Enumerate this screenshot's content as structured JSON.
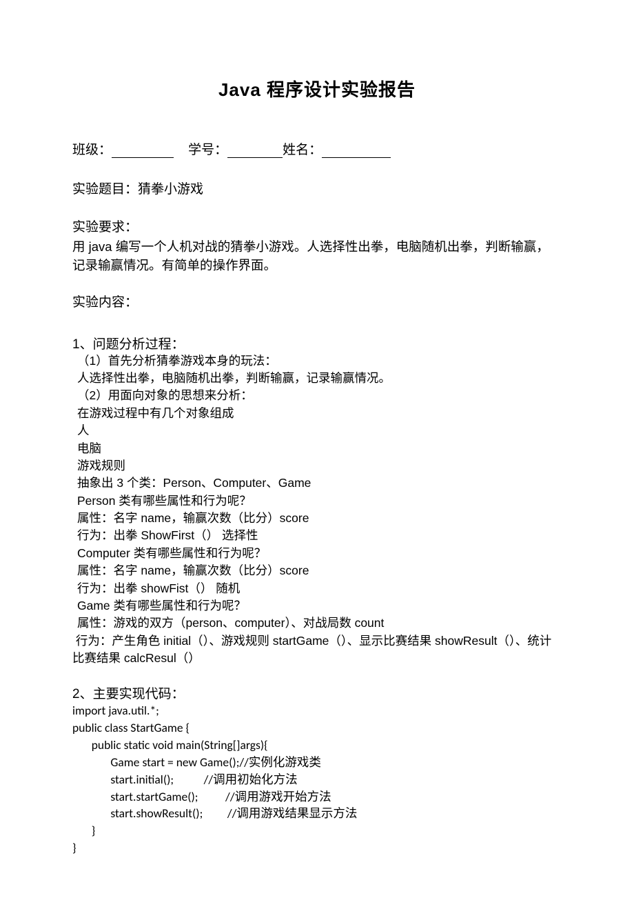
{
  "title": "Java 程序设计实验报告",
  "info": {
    "class_label": "班级：",
    "id_label": "学号：",
    "name_label": "姓名："
  },
  "topic": {
    "label": "实验题目：",
    "value": "猜拳小游戏"
  },
  "requirements": {
    "label": "实验要求：",
    "text": "用 java 编写一个人机对战的猜拳小游戏。人选择性出拳，电脑随机出拳，判断输赢，记录输赢情况。有简单的操作界面。"
  },
  "content_label": "实验内容：",
  "section1": {
    "heading": "1、问题分析过程：",
    "lines": [
      "（1）首先分析猜拳游戏本身的玩法：",
      "人选择性出拳，电脑随机出拳，判断输赢，记录输赢情况。",
      "（2）用面向对象的思想来分析：",
      "在游戏过程中有几个对象组成",
      "人",
      "电脑",
      "游戏规则",
      "抽象出 3 个类：Person、Computer、Game",
      "Person 类有哪些属性和行为呢？",
      "属性：名字 name，输赢次数（比分）score",
      "行为：出拳 ShowFirst（）      选择性",
      "Computer 类有哪些属性和行为呢？",
      "属性：名字 name，输赢次数（比分）score",
      "行为：出拳 showFist（）      随机",
      "Game 类有哪些属性和行为呢？",
      "属性：游戏的双方（person、computer）、对战局数 count"
    ],
    "wrap_line": "行为：产生角色 initial（）、游戏规则 startGame（）、显示比赛结果 showResult（）、统计比赛结果 calcResul（）"
  },
  "section2": {
    "heading": "2、主要实现代码：",
    "code": "import java.util.*;\npublic class StartGame {\n       public static void main(String[]args){\n              Game start = new Game();//实例化游戏类\n              start.initial();           //调用初始化方法\n              start.startGame();          //调用游戏开始方法\n              start.showResult();         //调用游戏结果显示方法\n       }\n}"
  }
}
